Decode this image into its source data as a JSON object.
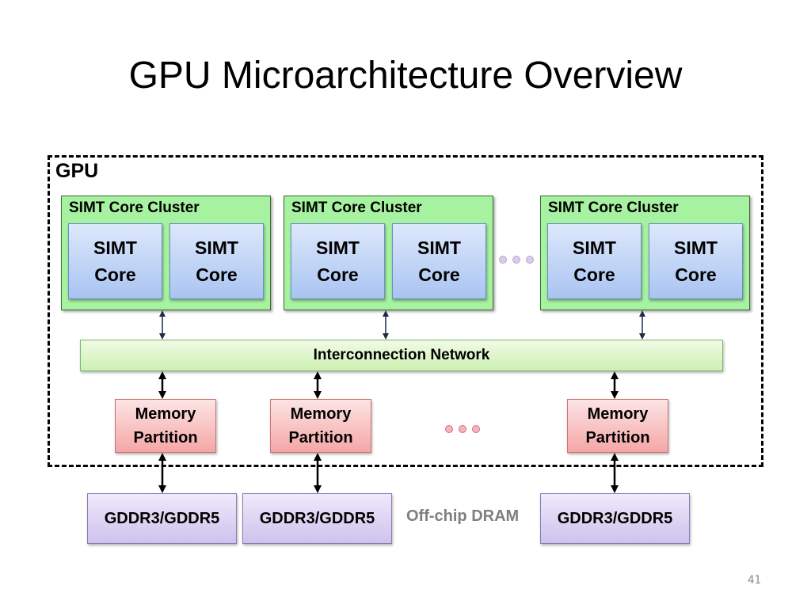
{
  "slide": {
    "title": "GPU Microarchitecture Overview",
    "page_number": "41"
  },
  "gpu": {
    "label": "GPU",
    "clusters": [
      {
        "label": "SIMT Core Cluster",
        "cores": [
          {
            "line1": "SIMT",
            "line2": "Core"
          },
          {
            "line1": "SIMT",
            "line2": "Core"
          }
        ]
      },
      {
        "label": "SIMT Core Cluster",
        "cores": [
          {
            "line1": "SIMT",
            "line2": "Core"
          },
          {
            "line1": "SIMT",
            "line2": "Core"
          }
        ]
      },
      {
        "label": "SIMT Core Cluster",
        "cores": [
          {
            "line1": "SIMT",
            "line2": "Core"
          },
          {
            "line1": "SIMT",
            "line2": "Core"
          }
        ]
      }
    ],
    "interconnect": {
      "label": "Interconnection Network"
    },
    "memory_partitions": [
      {
        "line1": "Memory",
        "line2": "Partition"
      },
      {
        "line1": "Memory",
        "line2": "Partition"
      },
      {
        "line1": "Memory",
        "line2": "Partition"
      }
    ]
  },
  "dram": {
    "label": "Off-chip DRAM",
    "modules": [
      {
        "label": "GDDR3/GDDR5"
      },
      {
        "label": "GDDR3/GDDR5"
      },
      {
        "label": "GDDR3/GDDR5"
      }
    ]
  },
  "colors": {
    "cluster_fill": "#a6f2a0",
    "core_fill": "#a9c4f2",
    "interconnect_fill": "#cdf0b2",
    "memory_fill": "#f5a6a6",
    "dram_fill": "#cec2ec",
    "offchip_text": "#7f7f7f"
  }
}
